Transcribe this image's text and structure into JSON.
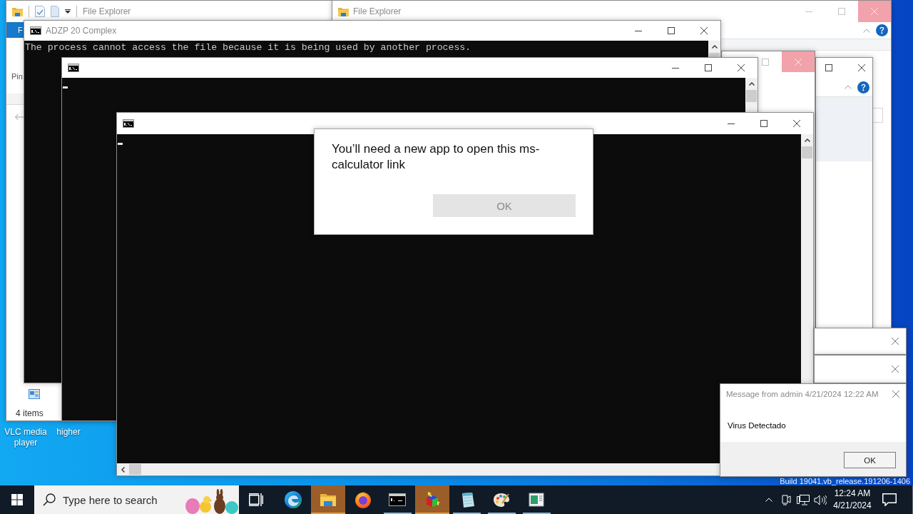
{
  "desktop_icons": [
    {
      "label": "VLC media player"
    },
    {
      "label": "higher"
    }
  ],
  "build_text": "Build 19041.vb_release.191206-1406",
  "explorer_back": {
    "title": "File Explorer",
    "ribbon_tab": "F",
    "ribbon_label": "Pin",
    "status": "4 items"
  },
  "explorer_front": {
    "title": "File Explorer"
  },
  "consoles": [
    {
      "title": "ADZP 20 Complex",
      "lines": [
        "The process cannot access the file because it is being used by another process."
      ],
      "cursor": false
    },
    {
      "cursor": true
    },
    {
      "cursor": true
    }
  ],
  "dialog": {
    "message": "You’ll need a new app to open this ms-calculator link",
    "button": "OK"
  },
  "message_box": {
    "title": "Message from admin 4/21/2024 12:22 AM",
    "body": "Virus Detectado",
    "button": "OK"
  },
  "taskbar": {
    "search_placeholder": "Type here to search",
    "apps": [
      {
        "kind": "wave",
        "open": false,
        "flashing": false
      },
      {
        "kind": "folder",
        "open": true,
        "flashing": true
      },
      {
        "kind": "fox",
        "open": false,
        "flashing": false
      },
      {
        "kind": "terminal",
        "open": true,
        "flashing": false
      },
      {
        "kind": "cube",
        "open": true,
        "flashing": true
      },
      {
        "kind": "pad",
        "open": true,
        "flashing": false
      },
      {
        "kind": "palette",
        "open": true,
        "flashing": false
      },
      {
        "kind": "viewer",
        "open": true,
        "flashing": false
      }
    ],
    "clock": {
      "time": "12:24 AM",
      "date": "4/21/2024"
    }
  }
}
